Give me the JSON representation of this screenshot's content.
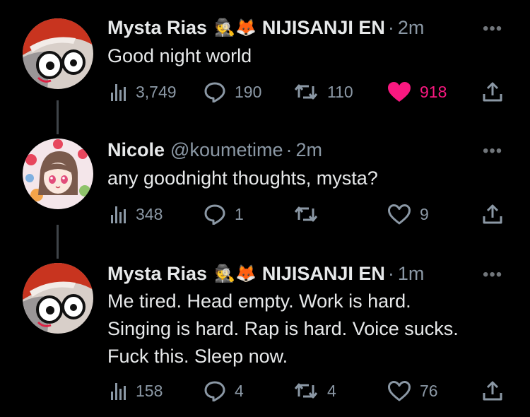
{
  "tweets": [
    {
      "author": "Mysta Rias",
      "emoji": "🕵️🦊",
      "affiliation": "NIJISANJI EN",
      "time": "2m",
      "text": "Good night world",
      "stats": {
        "views": "3,749",
        "replies": "190",
        "retweets": "110",
        "likes": "918"
      },
      "liked": true
    },
    {
      "author": "Nicole",
      "handle": "@koumetime",
      "time": "2m",
      "text": "any goodnight thoughts, mysta?",
      "stats": {
        "views": "348",
        "replies": "1",
        "retweets": "",
        "likes": "9"
      },
      "liked": false
    },
    {
      "author": "Mysta Rias",
      "emoji": "🕵️🦊",
      "affiliation": "NIJISANJI EN",
      "time": "1m",
      "text": "Me tired. Head empty. Work is hard.\nSinging is hard. Rap is hard. Voice sucks.\nFuck this. Sleep now.",
      "stats": {
        "views": "158",
        "replies": "4",
        "retweets": "4",
        "likes": "76"
      },
      "liked": false
    }
  ],
  "separator": "·",
  "more_glyph": "•••",
  "colors": {
    "background": "#000000",
    "text": "#e7e9ea",
    "muted": "#8b98a5",
    "like_active": "#f91880"
  },
  "icons": [
    "views-icon",
    "reply-icon",
    "retweet-icon",
    "like-icon",
    "share-icon",
    "more-icon"
  ]
}
